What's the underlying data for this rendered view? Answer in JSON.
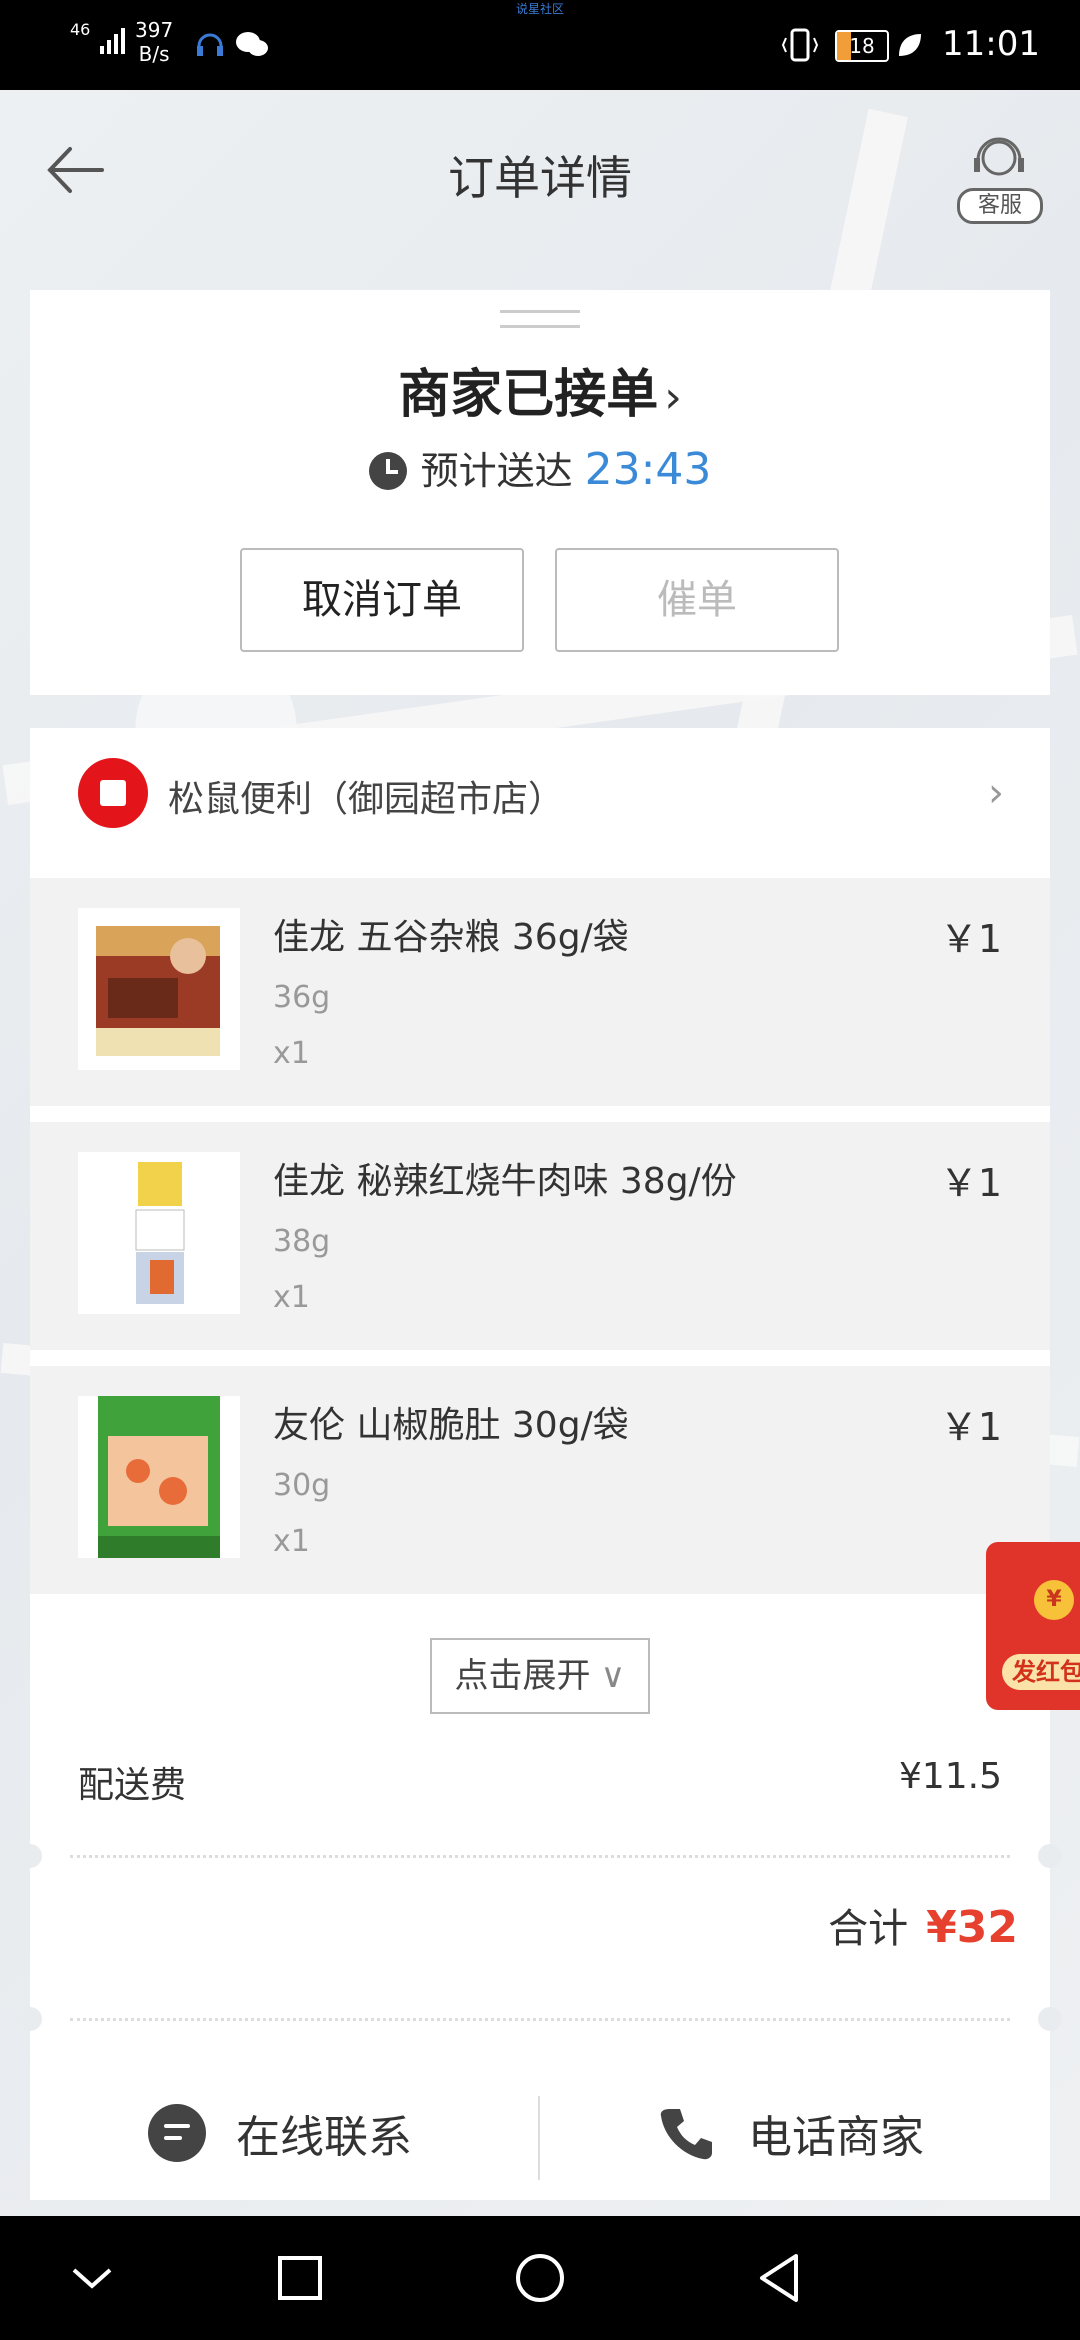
{
  "status_bar": {
    "carrier_text": "说星社区",
    "network": "46",
    "speed_value": "397",
    "speed_unit": "B/s",
    "battery": "18",
    "time": "11:01"
  },
  "header": {
    "title": "订单详情",
    "service_label": "客服"
  },
  "order": {
    "status": "商家已接单",
    "status_chevron": "›",
    "eta_label": "预计送达",
    "eta_time": "23:43",
    "cancel_label": "取消订单",
    "urge_label": "催单"
  },
  "shop": {
    "name": "松鼠便利（御园超市店）",
    "chevron": "›"
  },
  "items": [
    {
      "name": "佳龙 五谷杂粮 36g/袋",
      "spec": "36g",
      "qty": "x1",
      "price": "￥1"
    },
    {
      "name": "佳龙 秘辣红烧牛肉味 38g/份",
      "spec": "38g",
      "qty": "x1",
      "price": "￥1"
    },
    {
      "name": "友伦 山椒脆肚 30g/袋",
      "spec": "30g",
      "qty": "x1",
      "price": "￥1"
    }
  ],
  "expand_label": "点击展开",
  "expand_chevron": "∨",
  "delivery_fee": {
    "label": "配送费",
    "value": "¥11.5"
  },
  "total": {
    "label": "合计",
    "value": "¥32"
  },
  "contact": {
    "online_label": "在线联系",
    "phone_label": "电话商家"
  },
  "red_packet": {
    "coin": "¥",
    "label": "发红包"
  },
  "colors": {
    "accent_blue": "#3a8ad8",
    "price_red": "#e6402f",
    "packet_red": "#e0332a"
  }
}
